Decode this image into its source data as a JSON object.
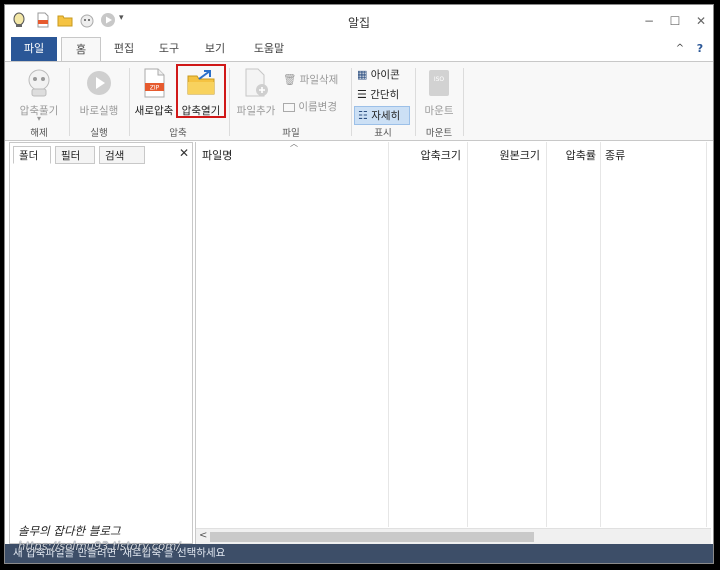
{
  "window": {
    "title": "알집",
    "controls": {
      "minimize": "−",
      "maximize": "☐",
      "close": "✕"
    }
  },
  "tabs": [
    "파일",
    "홈",
    "편집",
    "도구",
    "보기",
    "도움말"
  ],
  "tab_extras": {
    "collapse": "^",
    "help": "?"
  },
  "ribbon": {
    "extract_label": "압축풀기",
    "run_label": "바로실행",
    "new_archive_label": "새로압축",
    "open_archive_label": "압축열기",
    "add_file_label": "파일추가",
    "delete_file_label": "파일삭제",
    "rename_label": "이름변경",
    "view_icon_label": "아이콘",
    "view_simple_label": "간단히",
    "view_detail_label": "자세히",
    "mount_label": "마운트",
    "iso_text": "ISO",
    "zip_text": "ZIP",
    "groups": [
      "해제",
      "실행",
      "압축",
      "파일",
      "표시",
      "마운트"
    ]
  },
  "left_pane": {
    "tabs": [
      "폴더",
      "필터",
      "검색"
    ],
    "close": "✕"
  },
  "file_list": {
    "columns": [
      "파일명",
      "압축크기",
      "원본크기",
      "압축률",
      "종류"
    ],
    "scroll_left": "<"
  },
  "status_text": "새 압축파일을 만들려면 '새로압축'을 선택하세요",
  "watermark": {
    "line1": "솔무의 잡다한 블로그",
    "line2": "https://solmu93.tistory.com/"
  },
  "colors": {
    "file_tab": "#2b5797",
    "status_bar": "#3d4e68",
    "highlight": "#d01818",
    "folder": "#f5c342"
  }
}
